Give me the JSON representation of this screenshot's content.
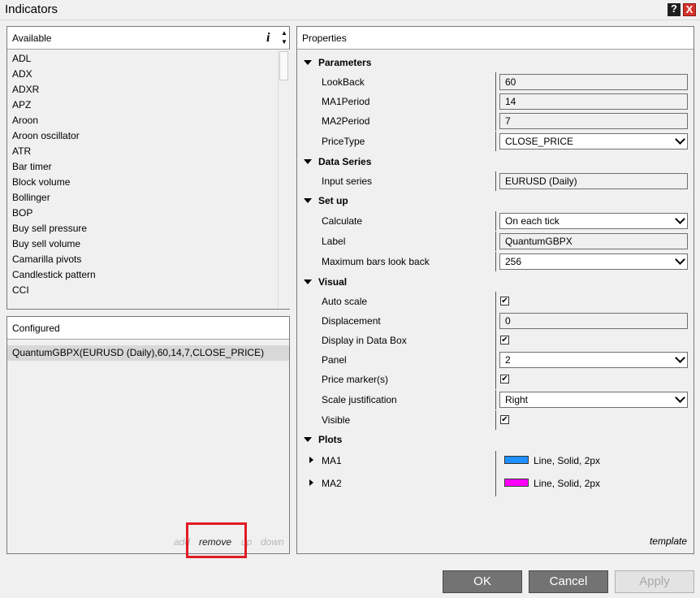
{
  "window": {
    "title": "Indicators",
    "help_label": "?",
    "close_label": "X"
  },
  "available": {
    "header": "Available",
    "info_icon": "i",
    "items": [
      "ADL",
      "ADX",
      "ADXR",
      "APZ",
      "Aroon",
      "Aroon oscillator",
      "ATR",
      "Bar timer",
      "Block volume",
      "Bollinger",
      "BOP",
      "Buy sell pressure",
      "Buy sell volume",
      "Camarilla pivots",
      "Candlestick pattern",
      "CCI"
    ]
  },
  "configured": {
    "header": "Configured",
    "items": [
      "QuantumGBPX(EURUSD (Daily),60,14,7,CLOSE_PRICE)"
    ],
    "actions": {
      "add": "add",
      "remove": "remove",
      "up": "up",
      "down": "down"
    }
  },
  "properties": {
    "header": "Properties",
    "categories": {
      "parameters": "Parameters",
      "data_series": "Data Series",
      "setup": "Set up",
      "visual": "Visual",
      "plots": "Plots"
    },
    "lookback": {
      "label": "LookBack",
      "value": "60"
    },
    "ma1period": {
      "label": "MA1Period",
      "value": "14"
    },
    "ma2period": {
      "label": "MA2Period",
      "value": "7"
    },
    "pricetype": {
      "label": "PriceType",
      "value": "CLOSE_PRICE"
    },
    "input_series": {
      "label": "Input series",
      "value": "EURUSD (Daily)"
    },
    "calculate": {
      "label": "Calculate",
      "value": "On each tick"
    },
    "label": {
      "label": "Label",
      "value": "QuantumGBPX"
    },
    "max_bars": {
      "label": "Maximum bars look back",
      "value": "256"
    },
    "auto_scale": {
      "label": "Auto scale",
      "checked": true
    },
    "displacement": {
      "label": "Displacement",
      "value": "0"
    },
    "display_data_box": {
      "label": "Display in Data Box",
      "checked": true
    },
    "panel": {
      "label": "Panel",
      "value": "2"
    },
    "price_markers": {
      "label": "Price marker(s)",
      "checked": true
    },
    "scale_justification": {
      "label": "Scale justification",
      "value": "Right"
    },
    "visible": {
      "label": "Visible",
      "checked": true
    },
    "plots": [
      {
        "label": "MA1",
        "style": "Line, Solid, 2px",
        "color": "#1e90ff"
      },
      {
        "label": "MA2",
        "style": "Line, Solid, 2px",
        "color": "#ff00ff"
      }
    ],
    "template_link": "template"
  },
  "buttons": {
    "ok": "OK",
    "cancel": "Cancel",
    "apply": "Apply"
  },
  "check_glyph": "✔"
}
